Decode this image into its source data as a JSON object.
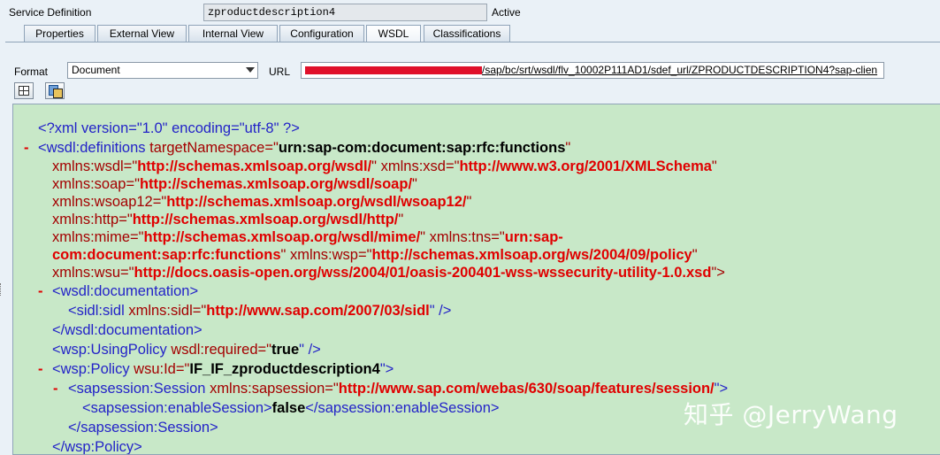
{
  "service_definition": {
    "label": "Service Definition",
    "value": "zproductdescription4",
    "status": "Active"
  },
  "tabs": [
    {
      "label": "Properties",
      "active": false
    },
    {
      "label": "External View",
      "active": false
    },
    {
      "label": "Internal View",
      "active": false
    },
    {
      "label": "Configuration",
      "active": false
    },
    {
      "label": "WSDL",
      "active": true
    },
    {
      "label": "Classifications",
      "active": false
    }
  ],
  "format": {
    "label": "Format",
    "value": "Document"
  },
  "url": {
    "label": "URL",
    "value_visible": "/sap/bc/srt/wsdl/flv_10002P111AD1/sdef_url/ZPRODUCTDESCRIPTION4?sap-clien"
  },
  "toolbar": {
    "btn1_icon": "grid-icon",
    "btn2_icon": "copy-icon"
  },
  "xml": {
    "l1": {
      "text": "<?xml version=\"1.0\" encoding=\"utf-8\" ?>"
    },
    "l2": {
      "open": "<wsdl:definitions ",
      "attr": "targetNamespace=\"",
      "val": "urn:sap-com:document:sap:rfc:functions",
      "close": "\""
    },
    "l3": {
      "a1": "xmlns:wsdl=\"",
      "v1": "http://schemas.xmlsoap.org/wsdl/",
      "a2": "\" xmlns:xsd=\"",
      "v2": "http://www.w3.org/2001/XMLSchema",
      "c": "\""
    },
    "l4": {
      "a1": "xmlns:soap=\"",
      "v1": "http://schemas.xmlsoap.org/wsdl/soap/",
      "c": "\""
    },
    "l5": {
      "a1": "xmlns:wsoap12=\"",
      "v1": "http://schemas.xmlsoap.org/wsdl/wsoap12/",
      "c": "\""
    },
    "l6": {
      "a1": "xmlns:http=\"",
      "v1": "http://schemas.xmlsoap.org/wsdl/http/",
      "c": "\""
    },
    "l7": {
      "a1": "xmlns:mime=\"",
      "v1": "http://schemas.xmlsoap.org/wsdl/mime/",
      "a2": "\" xmlns:tns=\"",
      "v2": "urn:sap-"
    },
    "l8": {
      "v0": "com:document:sap:rfc:functions",
      "a1": "\" xmlns:wsp=\"",
      "v1": "http://schemas.xmlsoap.org/ws/2004/09/policy",
      "c": "\""
    },
    "l9": {
      "a1": "xmlns:wsu=\"",
      "v1": "http://docs.oasis-open.org/wss/2004/01/oasis-200401-wss-wssecurity-utility-1.0.xsd",
      "c": "\">"
    },
    "l10": {
      "text": "<wsdl:documentation>"
    },
    "l11": {
      "open": "<sidl:sidl ",
      "attr": "xmlns:sidl=\"",
      "val": "http://www.sap.com/2007/03/sidl",
      "close": "\" />"
    },
    "l12": {
      "text": "</wsdl:documentation>"
    },
    "l13": {
      "open": "<wsp:UsingPolicy ",
      "attr": "wsdl:required=\"",
      "val": "true",
      "close": "\" />"
    },
    "l14": {
      "open": "<wsp:Policy ",
      "attr": "wsu:Id=\"",
      "val": "IF_IF_zproductdescription4",
      "close": "\">"
    },
    "l15": {
      "open": "<sapsession:Session ",
      "attr": "xmlns:sapsession=\"",
      "val": "http://www.sap.com/webas/630/soap/features/session/",
      "close": "\">"
    },
    "l16": {
      "open": "<sapsession:enableSession>",
      "val": "false",
      "close": "</sapsession:enableSession>"
    },
    "l17": {
      "text": "</sapsession:Session>"
    },
    "l18": {
      "text": "</wsp:Policy>"
    },
    "collapse_marker": "-"
  },
  "watermark": "知乎 @JerryWang",
  "colors": {
    "pane_bg": "#c8e8c8",
    "tag": "#2323c8",
    "attr": "#a40000",
    "value": "#e00000"
  }
}
